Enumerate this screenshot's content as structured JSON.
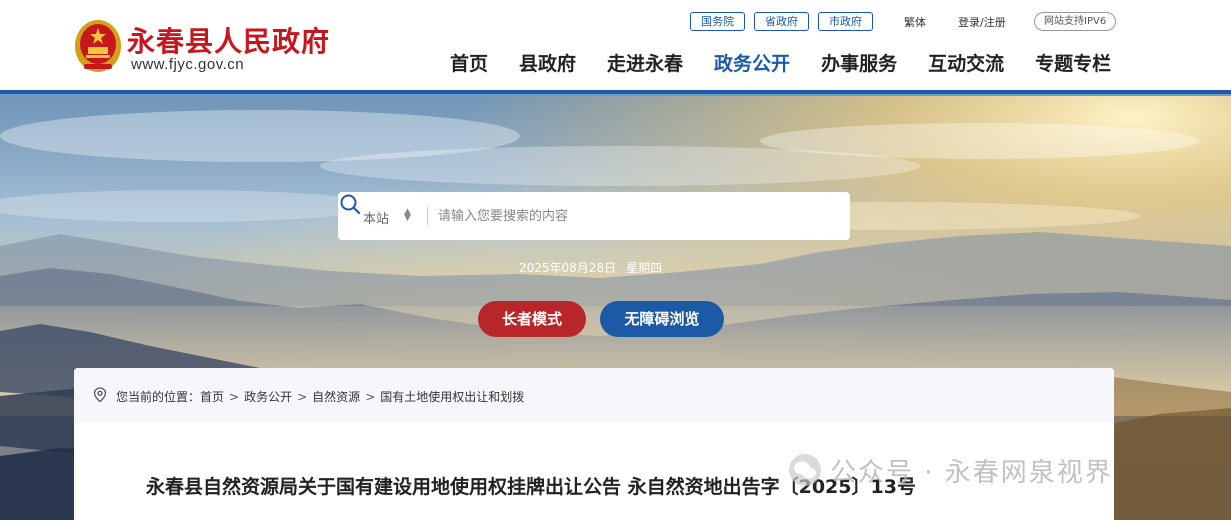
{
  "header": {
    "site_name": "永春县人民政府",
    "site_url": "www.fjyc.gov.cn",
    "gov_links": [
      "国务院",
      "省政府",
      "市政府"
    ],
    "traditional_label": "繁体",
    "login_label": "登录/注册",
    "ipv6_label": "网站支持IPV6"
  },
  "nav": {
    "items": [
      "首页",
      "县政府",
      "走进永春",
      "政务公开",
      "办事服务",
      "互动交流",
      "专题专栏"
    ],
    "active": "政务公开"
  },
  "search": {
    "scope": "本站",
    "placeholder": "请输入您要搜索的内容"
  },
  "date": {
    "date": "2025年08月28日",
    "weekday": "星期四"
  },
  "buttons": {
    "elder_mode": "长者模式",
    "accessible": "无障碍浏览"
  },
  "breadcrumb": {
    "prefix": "您当前的位置：",
    "items": [
      "首页",
      "政务公开",
      "自然资源",
      "国有土地使用权出让和划拨"
    ]
  },
  "article": {
    "title": "永春县自然资源局关于国有建设用地使用权挂牌出让公告 永自然资地出告字〔2025〕13号"
  },
  "watermark": {
    "text": "公众号 · 永春网泉视界"
  },
  "colors": {
    "brand_red": "#c8161d",
    "brand_blue": "#1a5aa8",
    "elder_button": "#b8262a",
    "access_button": "#1d5aa5"
  }
}
